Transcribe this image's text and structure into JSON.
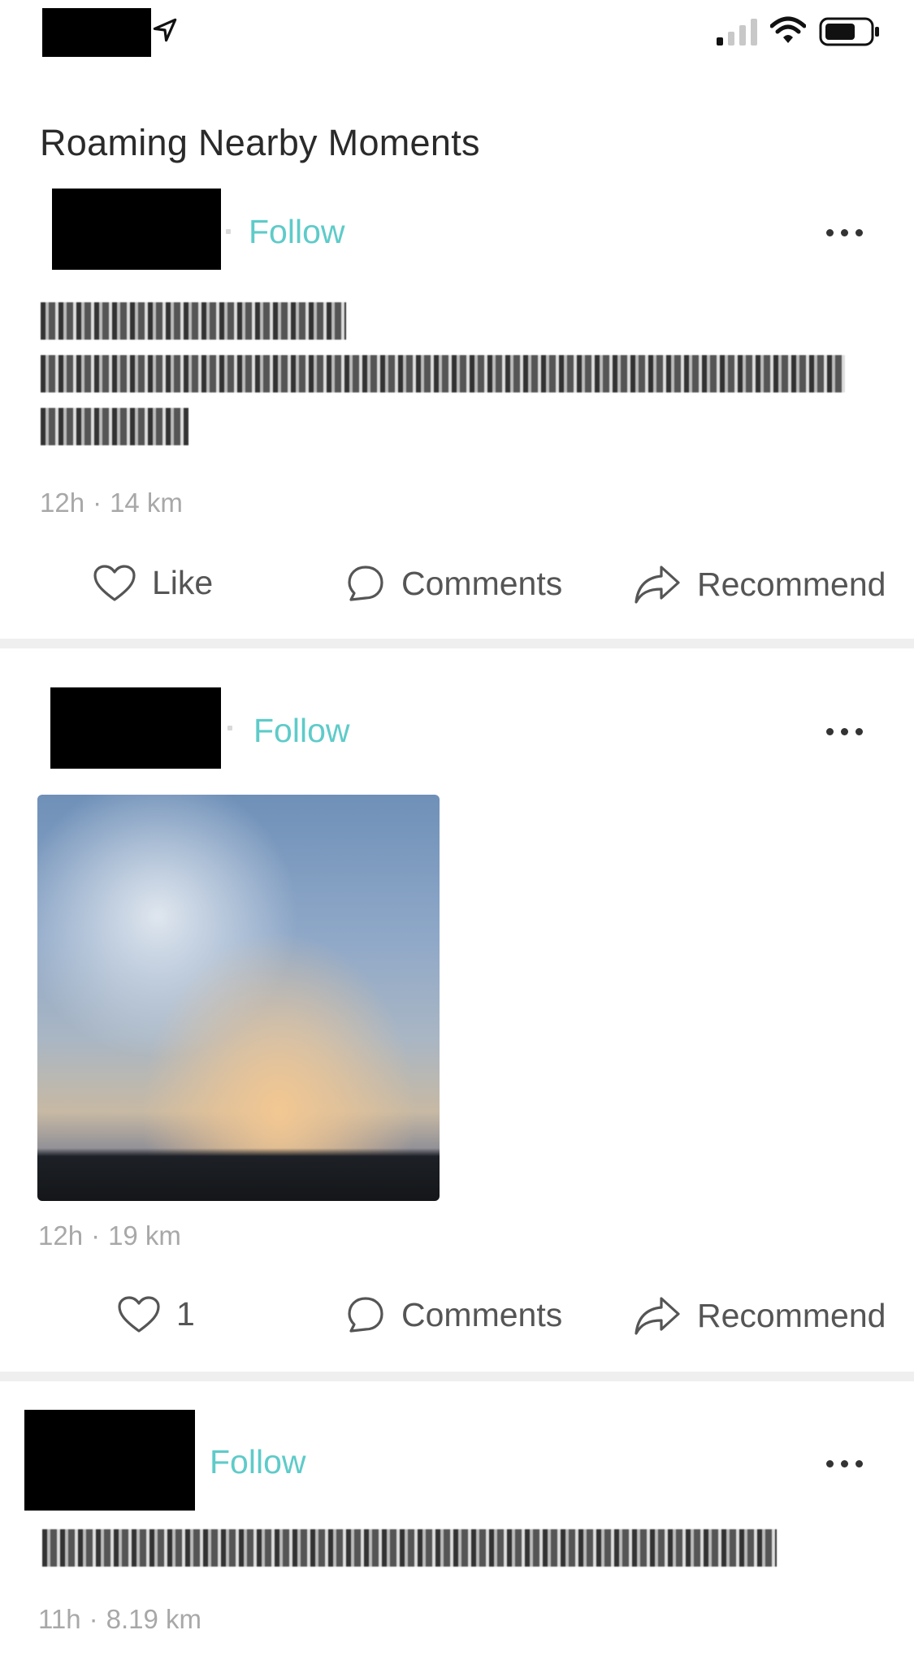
{
  "header": {
    "title": "Roaming Nearby Moments"
  },
  "posts": [
    {
      "follow_label": "Follow",
      "meta_time": "12h",
      "meta_sep": "·",
      "meta_distance": "14 km",
      "actions": {
        "like": "Like",
        "comments": "Comments",
        "recommend": "Recommend"
      }
    },
    {
      "follow_label": "Follow",
      "meta_time": "12h",
      "meta_sep": "·",
      "meta_distance": "19 km",
      "actions": {
        "like": "1",
        "comments": "Comments",
        "recommend": "Recommend"
      }
    },
    {
      "follow_label": "Follow",
      "meta_time": "11h",
      "meta_sep": "·",
      "meta_distance": "8.19 km"
    }
  ],
  "colors": {
    "accent": "#5ecbc9",
    "muted": "#a8a8a8",
    "divider": "#efefef"
  },
  "icons": [
    "location-arrow-icon",
    "signal-icon",
    "wifi-icon",
    "battery-icon",
    "more-icon",
    "heart-icon",
    "comment-icon",
    "share-icon"
  ]
}
